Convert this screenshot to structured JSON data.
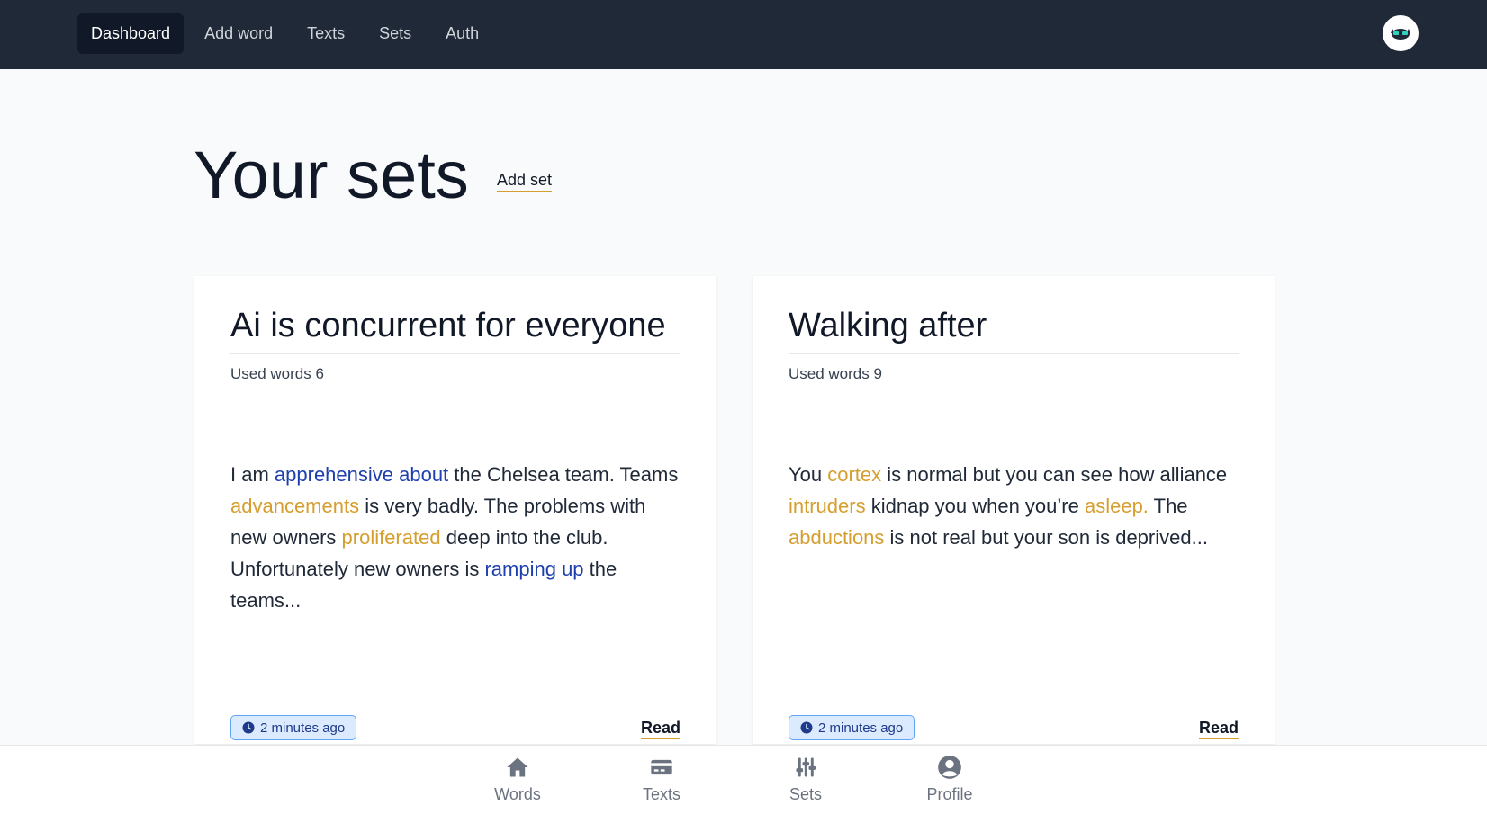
{
  "nav": {
    "items": [
      {
        "label": "Dashboard",
        "active": true
      },
      {
        "label": "Add word"
      },
      {
        "label": "Texts"
      },
      {
        "label": "Sets"
      },
      {
        "label": "Auth"
      }
    ]
  },
  "header": {
    "title": "Your sets",
    "add_label": "Add set"
  },
  "cards": [
    {
      "title": "Ai is concurrent for everyone",
      "used_words": "Used words 6",
      "time": "2 minutes ago",
      "read": "Read",
      "text": [
        {
          "t": "I am "
        },
        {
          "t": "apprehensive about",
          "c": "blue"
        },
        {
          "t": " the Chelsea team. Teams "
        },
        {
          "t": "advancements",
          "c": "orange"
        },
        {
          "t": " is very badly. The problems with new owners "
        },
        {
          "t": "proliferated",
          "c": "orange"
        },
        {
          "t": " deep into the club. Unfortunately new owners is "
        },
        {
          "t": "ramping up",
          "c": "blue"
        },
        {
          "t": " the teams..."
        }
      ]
    },
    {
      "title": "Walking after",
      "used_words": "Used words 9",
      "time": "2 minutes ago",
      "read": "Read",
      "text": [
        {
          "t": "You "
        },
        {
          "t": "cortex",
          "c": "orange"
        },
        {
          "t": " is normal but you can see how alliance "
        },
        {
          "t": "intruders",
          "c": "orange"
        },
        {
          "t": " kidnap you when you’re "
        },
        {
          "t": "asleep.",
          "c": "orange"
        },
        {
          "t": " The "
        },
        {
          "t": "abductions",
          "c": "orange"
        },
        {
          "t": " is not real but your son is deprived..."
        }
      ]
    }
  ],
  "bottom": {
    "items": [
      {
        "label": "Words",
        "icon": "home-icon"
      },
      {
        "label": "Texts",
        "icon": "card-icon"
      },
      {
        "label": "Sets",
        "icon": "sliders-icon"
      },
      {
        "label": "Profile",
        "icon": "user-circle-icon"
      }
    ]
  },
  "colors": {
    "nav_bg": "#1f2937",
    "highlight_blue": "#1e40af",
    "highlight_orange": "#d69e2e",
    "badge_bg": "#dbeafe"
  }
}
